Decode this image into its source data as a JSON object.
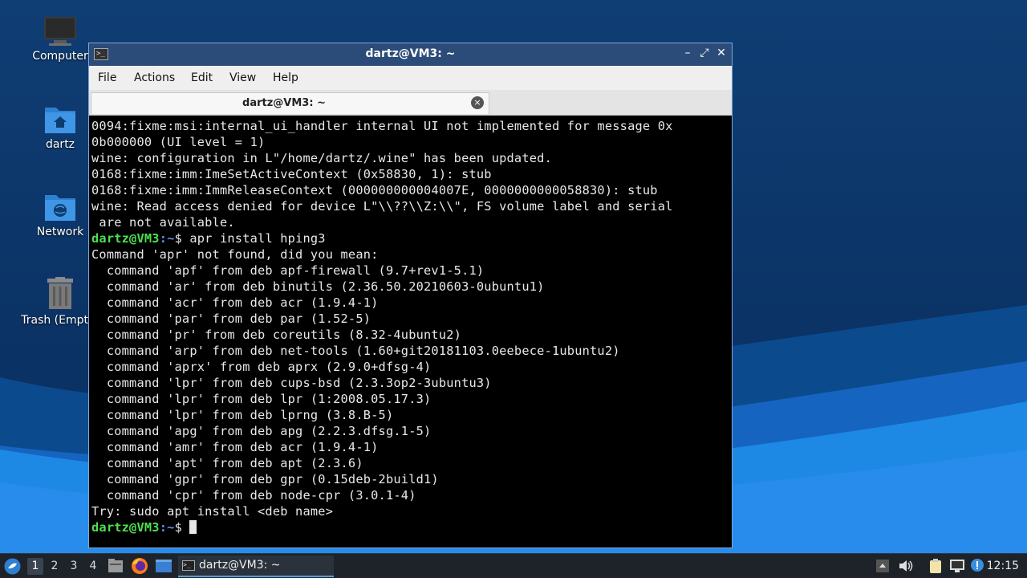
{
  "desktop": {
    "icons": [
      {
        "label": "Computer"
      },
      {
        "label": "dartz"
      },
      {
        "label": "Network"
      },
      {
        "label": "Trash (Empty)"
      }
    ]
  },
  "window": {
    "title": "dartz@VM3: ~",
    "controls": {
      "minimize": "–",
      "maximize": "⤢",
      "close": "✕"
    },
    "menu": [
      "File",
      "Actions",
      "Edit",
      "View",
      "Help"
    ],
    "tab": {
      "label": "dartz@VM3: ~",
      "close": "×"
    }
  },
  "terminal": {
    "prompt_user": "dartz@VM3",
    "prompt_path": ":~",
    "prompt_symbol": "$ ",
    "lines_before": [
      "0094:fixme:msi:internal_ui_handler internal UI not implemented for message 0x",
      "0b000000 (UI level = 1)",
      "wine: configuration in L\"/home/dartz/.wine\" has been updated.",
      "0168:fixme:imm:ImeSetActiveContext (0x58830, 1): stub",
      "0168:fixme:imm:ImmReleaseContext (000000000004007E, 0000000000058830): stub",
      "wine: Read access denied for device L\"\\\\??\\\\Z:\\\\\", FS volume label and serial",
      " are not available."
    ],
    "command": "apr install hping3",
    "output": [
      "Command 'apr' not found, did you mean:",
      "  command 'apf' from deb apf-firewall (9.7+rev1-5.1)",
      "  command 'ar' from deb binutils (2.36.50.20210603-0ubuntu1)",
      "  command 'acr' from deb acr (1.9.4-1)",
      "  command 'par' from deb par (1.52-5)",
      "  command 'pr' from deb coreutils (8.32-4ubuntu2)",
      "  command 'arp' from deb net-tools (1.60+git20181103.0eebece-1ubuntu2)",
      "  command 'aprx' from deb aprx (2.9.0+dfsg-4)",
      "  command 'lpr' from deb cups-bsd (2.3.3op2-3ubuntu3)",
      "  command 'lpr' from deb lpr (1:2008.05.17.3)",
      "  command 'lpr' from deb lprng (3.8.B-5)",
      "  command 'apg' from deb apg (2.2.3.dfsg.1-5)",
      "  command 'amr' from deb acr (1.9.4-1)",
      "  command 'apt' from deb apt (2.3.6)",
      "  command 'gpr' from deb gpr (0.15deb-2build1)",
      "  command 'cpr' from deb node-cpr (3.0.1-4)",
      "Try: sudo apt install <deb name>"
    ]
  },
  "taskbar": {
    "workspaces": [
      "1",
      "2",
      "3",
      "4"
    ],
    "active_workspace": "1",
    "task_label": "dartz@VM3: ~",
    "clock": "12:15"
  }
}
